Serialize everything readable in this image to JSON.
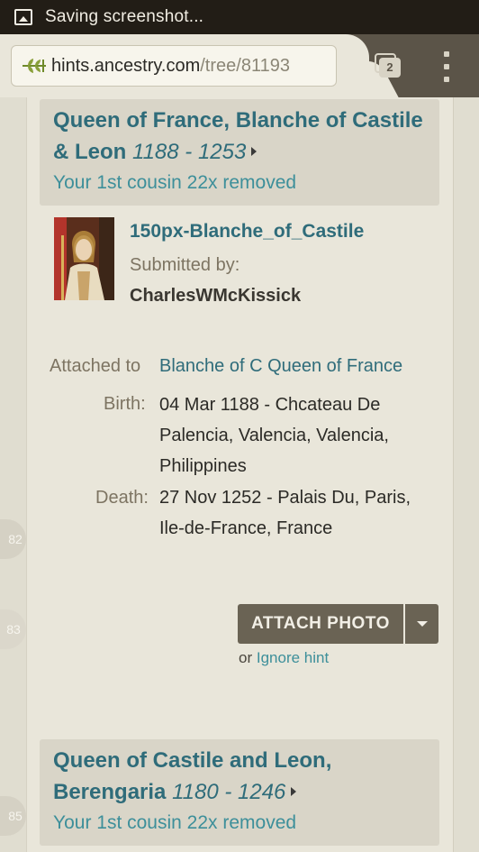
{
  "status_bar": {
    "text": "Saving screenshot..."
  },
  "browser": {
    "url_host": "hints.ancestry.com",
    "url_path": "/tree/81193",
    "tab_count": "2"
  },
  "hint_card": {
    "person": {
      "name_line1": "Queen of France, Blanche of Castile",
      "name_line2": "& Leon",
      "dates": "1188 - 1253",
      "relationship": "Your 1st cousin 22x removed"
    },
    "photo": {
      "title": "150px-Blanche_of_Castile",
      "submitted_by_label": "Submitted by:",
      "submitter": "CharlesWMcKissick"
    },
    "attached_label": "Attached to",
    "attached_value": "Blanche of C Queen of France",
    "birth_label": "Birth:",
    "birth_line1": "04 Mar 1188 - Chcateau De",
    "birth_line2": "Palencia, Valencia, Valencia,",
    "birth_line3": "Philippines",
    "death_label": "Death:",
    "death_line1": "27 Nov 1252 - Palais Du, Paris,",
    "death_line2": "Ile-de-France, France",
    "attach_button": "ATTACH PHOTO",
    "or_text": "or",
    "ignore_link": "Ignore hint"
  },
  "next_card": {
    "name_line1": "Queen of Castile and Leon,",
    "name_line2": "Berengaria",
    "dates": "1180 - 1246",
    "relationship": "Your 1st cousin 22x removed"
  },
  "markers": [
    "82",
    "83",
    "85"
  ],
  "colors": {
    "accent_teal": "#2f6c7a",
    "button": "#6a6354",
    "marker_accent": "#e7864f"
  }
}
